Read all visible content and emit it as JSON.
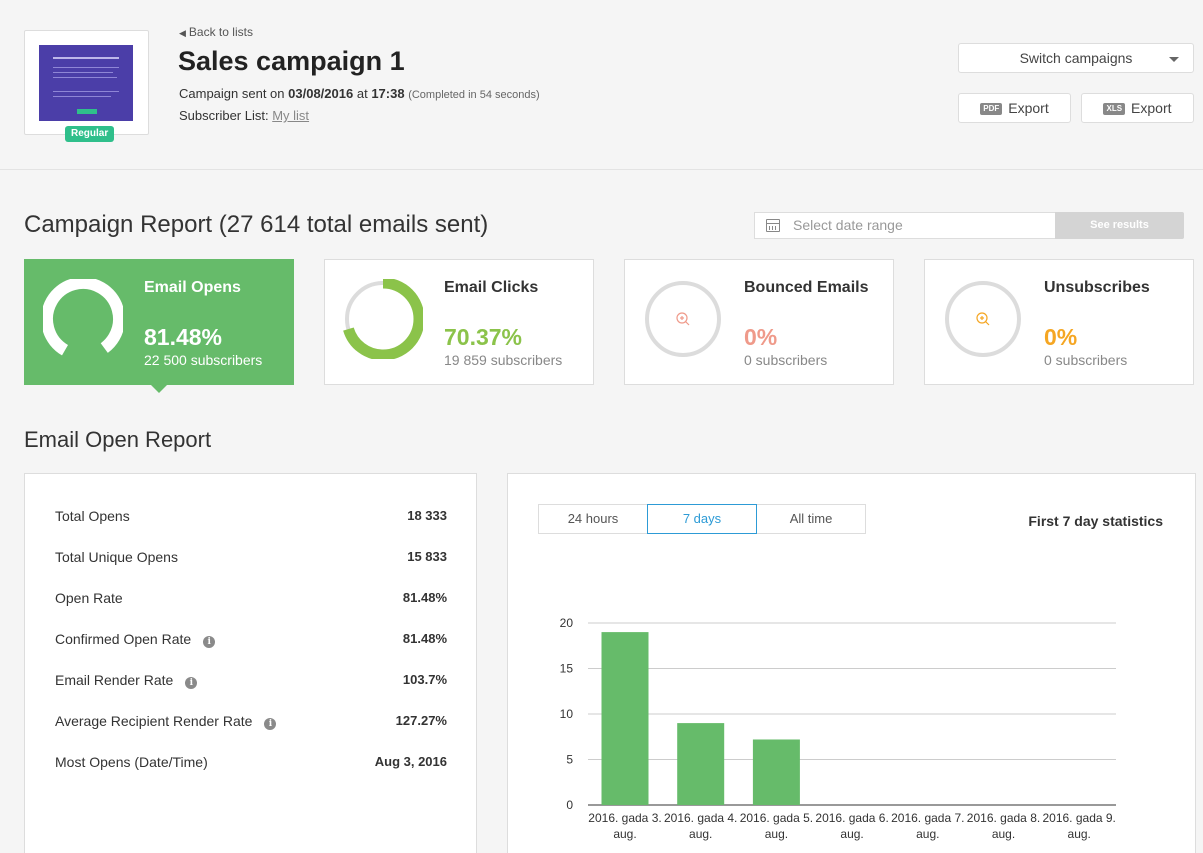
{
  "header": {
    "back_link": "Back to lists",
    "title": "Sales campaign 1",
    "sent_prefix": "Campaign sent on",
    "sent_date": "03/08/2016",
    "sent_at": "at",
    "sent_time": "17:38",
    "completed": "(Completed in 54 seconds)",
    "subscriber_list_label": "Subscriber List:",
    "subscriber_list_link": "My list",
    "badge": "Regular",
    "switch_campaigns": "Switch campaigns",
    "export_pdf_tag": "PDF",
    "export_pdf_label": "Export",
    "export_xls_tag": "XLS",
    "export_xls_label": "Export"
  },
  "report": {
    "title": "Campaign Report (27 614 total emails sent)",
    "date_placeholder": "Select date range",
    "see_results": "See results"
  },
  "cards": [
    {
      "title": "Email Opens",
      "percent": "81.48%",
      "subscribers": "22 500 subscribers",
      "fraction": 0.8148,
      "color": "#ffffff"
    },
    {
      "title": "Email Clicks",
      "percent": "70.37%",
      "subscribers": "19 859 subscribers",
      "fraction": 0.7037,
      "color": "#8bc34a"
    },
    {
      "title": "Bounced Emails",
      "percent": "0%",
      "subscribers": "0 subscribers",
      "fraction": 0,
      "color": "#ef9a8a"
    },
    {
      "title": "Unsubscribes",
      "percent": "0%",
      "subscribers": "0 subscribers",
      "fraction": 0,
      "color": "#f5a623"
    }
  ],
  "open_report": {
    "title": "Email Open Report",
    "rows": [
      {
        "label": "Total Opens",
        "value": "18 333"
      },
      {
        "label": "Total Unique Opens",
        "value": "15 833"
      },
      {
        "label": "Open Rate",
        "value": "81.48%"
      },
      {
        "label": "Confirmed Open Rate",
        "value": "81.48%"
      },
      {
        "label": "Email Render Rate",
        "value": "103.7%"
      },
      {
        "label": "Average Recipient Render Rate",
        "value": "127.27%"
      },
      {
        "label": "Most Opens (Date/Time)",
        "value": "Aug 3, 2016"
      }
    ],
    "tabs": [
      "24 hours",
      "7 days",
      "All time"
    ],
    "active_tab": "7 days",
    "chart_heading": "First 7 day statistics"
  },
  "chart_data": {
    "type": "bar",
    "categories": [
      "2016. gada 3. aug.",
      "2016. gada 4. aug.",
      "2016. gada 5. aug.",
      "2016. gada 6. aug.",
      "2016. gada 7. aug.",
      "2016. gada 8. aug.",
      "2016. gada 9. aug."
    ],
    "values": [
      19,
      9,
      7.2,
      0,
      0,
      0,
      0
    ],
    "ylim": [
      0,
      20
    ],
    "yticks": [
      0,
      5,
      10,
      15,
      20
    ],
    "grid": true,
    "bar_color": "#66bb6a"
  }
}
